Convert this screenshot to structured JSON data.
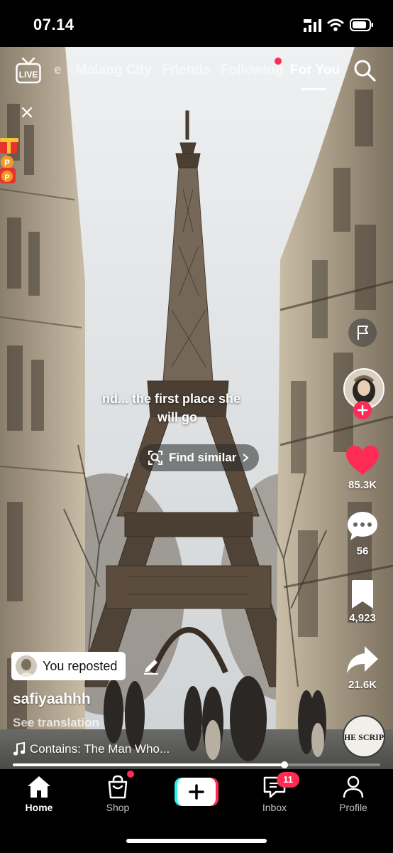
{
  "status_bar": {
    "time": "07.14"
  },
  "top_nav": {
    "live_label": "LIVE",
    "tabs": [
      {
        "label": "e",
        "state": "dim"
      },
      {
        "label": "Malang City",
        "state": "dim"
      },
      {
        "label": "Friends",
        "state": "dim"
      },
      {
        "label": "Following",
        "state": "dim",
        "has_dot": true
      },
      {
        "label": "For You",
        "state": "active"
      }
    ]
  },
  "video": {
    "caption_lines": [
      "nd... the first place she",
      "will go"
    ],
    "find_similar_label": "Find similar",
    "playback_progress": 0.74
  },
  "actions": {
    "likes": "85.3K",
    "comments": "56",
    "saves": "4,923",
    "shares": "21.6K"
  },
  "post": {
    "repost_label": "You reposted",
    "username": "safiyaahhh",
    "see_translation": "See translation",
    "music": "Contains: The Man Who...",
    "music_disc_text": "THE SCRIPT"
  },
  "bottom_nav": {
    "items": [
      {
        "label": "Home",
        "icon": "home-icon",
        "active": true
      },
      {
        "label": "Shop",
        "icon": "shop-bag-icon",
        "active": false,
        "has_dot": true
      },
      {
        "label": "Inbox",
        "icon": "inbox-icon",
        "active": false,
        "badge": "11"
      },
      {
        "label": "Profile",
        "icon": "profile-icon",
        "active": false
      }
    ]
  },
  "colors": {
    "accent": "#fe2c55",
    "create_left": "#25f4ee",
    "create_right": "#fe2c55"
  }
}
